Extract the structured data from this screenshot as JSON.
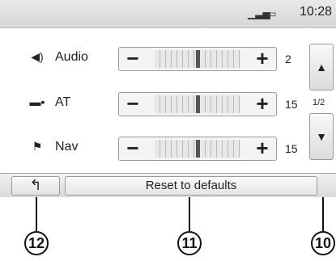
{
  "status_bar": {
    "signal_icon": "signal-bars-icon",
    "media_icon": "media-card-icon",
    "time": "10:28"
  },
  "rows": [
    {
      "icon": "speaker-icon",
      "icon_glyph": "◀)",
      "label": "Audio",
      "value": "2",
      "level_fraction": 0.5
    },
    {
      "icon": "phone-car-icon",
      "icon_glyph": "▬▪",
      "label": "AT",
      "value": "15",
      "level_fraction": 0.5
    },
    {
      "icon": "checkered-flag-icon",
      "icon_glyph": "⚑",
      "label": "Nav",
      "value": "15",
      "level_fraction": 0.5
    }
  ],
  "stepper": {
    "minus_label": "−",
    "plus_label": "+"
  },
  "scroll": {
    "up_glyph": "▲",
    "down_glyph": "▼",
    "page_indicator": "1/2"
  },
  "bottom_bar": {
    "back_glyph": "↰",
    "reset_label": "Reset to defaults"
  },
  "callouts": {
    "back": "12",
    "reset": "11",
    "scroll": "10"
  }
}
